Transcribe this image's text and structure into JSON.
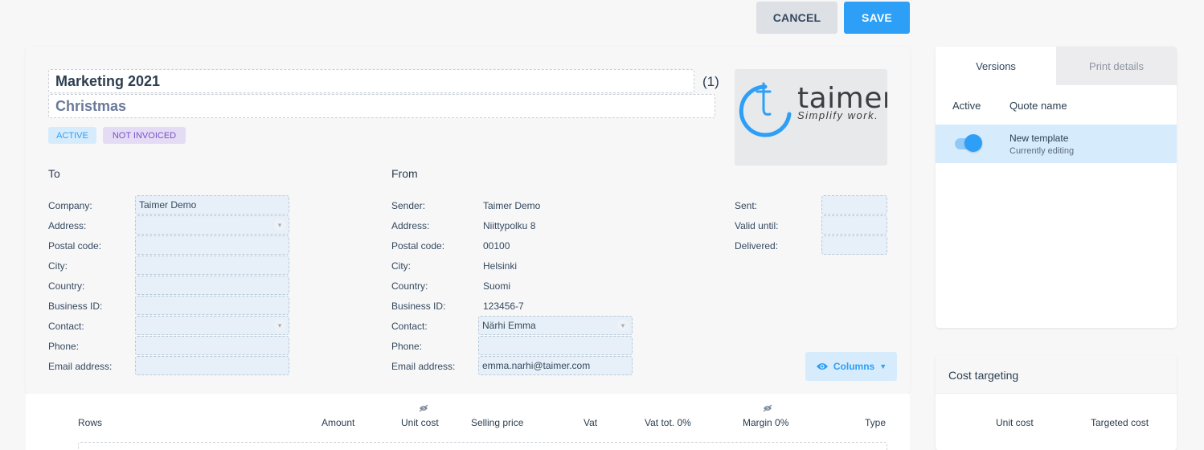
{
  "toolbar": {
    "cancel_label": "CANCEL",
    "save_label": "SAVE"
  },
  "quote": {
    "title": "Marketing 2021",
    "count": "(1)",
    "subtitle": "Christmas",
    "badges": {
      "active": "ACTIVE",
      "not_invoiced": "NOT INVOICED"
    }
  },
  "logo": {
    "brand": "taimer",
    "tagline": "Simplify work."
  },
  "to": {
    "heading": "To",
    "labels": {
      "company": "Company:",
      "address": "Address:",
      "postal_code": "Postal code:",
      "city": "City:",
      "country": "Country:",
      "business_id": "Business ID:",
      "contact": "Contact:",
      "phone": "Phone:",
      "email": "Email address:"
    },
    "values": {
      "company": "Taimer Demo",
      "address": "",
      "postal_code": "",
      "city": "",
      "country": "",
      "business_id": "",
      "contact": "",
      "phone": "",
      "email": ""
    }
  },
  "from": {
    "heading": "From",
    "labels": {
      "sender": "Sender:",
      "address": "Address:",
      "postal_code": "Postal code:",
      "city": "City:",
      "country": "Country:",
      "business_id": "Business ID:",
      "contact": "Contact:",
      "phone": "Phone:",
      "email": "Email address:"
    },
    "values": {
      "sender": "Taimer Demo",
      "address": "Niittypolku 8",
      "postal_code": "00100",
      "city": "Helsinki",
      "country": "Suomi",
      "business_id": "123456-7",
      "contact": "Närhi Emma",
      "phone": "",
      "email": "emma.narhi@taimer.com"
    }
  },
  "dates": {
    "sent_label": "Sent:",
    "valid_until_label": "Valid until:",
    "delivered_label": "Delivered:",
    "sent": "",
    "valid_until": "",
    "delivered": ""
  },
  "columns_button": {
    "label": "Columns"
  },
  "rows_table": {
    "headers": [
      "Rows",
      "Amount",
      "Unit cost",
      "Selling price",
      "Vat",
      "Vat tot. 0%",
      "Margin 0%",
      "Type"
    ]
  },
  "versions_panel": {
    "tabs": [
      "Versions",
      "Print details"
    ],
    "headers": {
      "active": "Active",
      "quote_name": "Quote name"
    },
    "rows": [
      {
        "name": "New template",
        "status": "Currently editing",
        "active": true
      }
    ]
  },
  "cost_targeting": {
    "title": "Cost targeting",
    "headers": [
      "Unit cost",
      "Targeted cost"
    ]
  },
  "colors": {
    "accent": "#2d9ff7",
    "badge_active": "#d6ecfc",
    "badge_not_invoiced": "#e4dcf5"
  }
}
